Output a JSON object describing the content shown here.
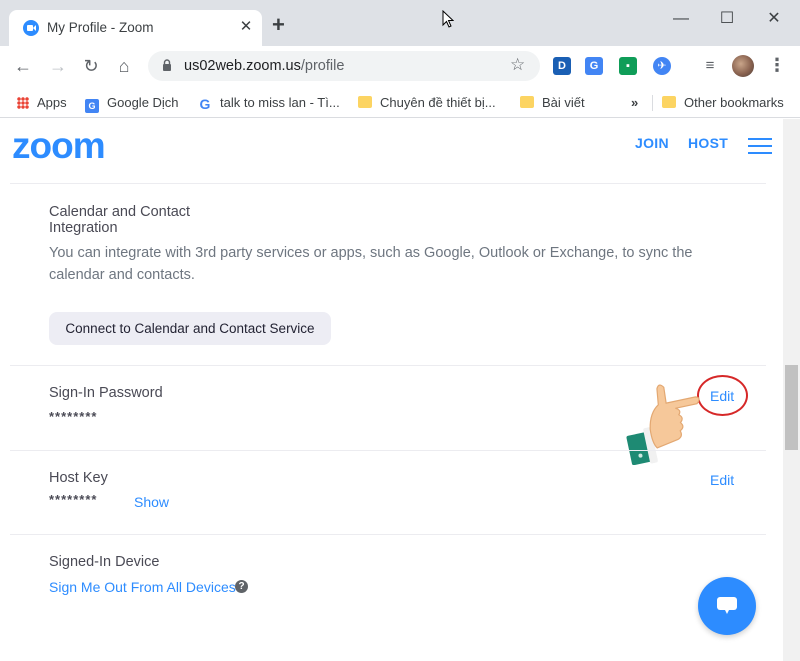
{
  "browser": {
    "tab_title": "My Profile - Zoom",
    "url_host": "us02web.zoom.us",
    "url_path": "/profile",
    "new_tab_icon": "plus-icon",
    "extensions": [
      {
        "name": "D",
        "color": "#1a5fb4"
      },
      {
        "name": "translate",
        "color": "#4285f4"
      },
      {
        "name": "classroom",
        "color": "#0f9d58"
      },
      {
        "name": "compass",
        "color": "#4285f4"
      }
    ],
    "bookmarks": [
      {
        "label": "Apps",
        "icon": "apps-grid-icon"
      },
      {
        "label": "Google Dịch",
        "icon": "google-translate-icon"
      },
      {
        "label": "talk to miss lan - Tì...",
        "icon": "google-g-icon"
      },
      {
        "label": "Chuyên đề thiết bị...",
        "icon": "folder-icon"
      },
      {
        "label": "Bài viết",
        "icon": "folder-icon"
      },
      {
        "label": "»",
        "icon": ""
      },
      {
        "label": "Other bookmarks",
        "icon": "folder-icon"
      }
    ]
  },
  "header": {
    "logo": "zoom",
    "join_label": "JOIN",
    "host_label": "HOST",
    "brand_color": "#2d8cff"
  },
  "calendar": {
    "title_line1": "Calendar and Contact",
    "title_line2": "Integration",
    "description": "You can integrate with 3rd party services or apps, such as Google, Outlook or Exchange, to sync the calendar and contacts.",
    "button_label": "Connect to Calendar and Contact Service"
  },
  "password": {
    "title": "Sign-In Password",
    "masked_value": "********",
    "edit_label": "Edit"
  },
  "host_key": {
    "title": "Host Key",
    "masked_value": "********",
    "show_label": "Show",
    "edit_label": "Edit"
  },
  "device": {
    "title": "Signed-In Device",
    "sign_out_label": "Sign Me Out From All Devices",
    "help_glyph": "?"
  }
}
